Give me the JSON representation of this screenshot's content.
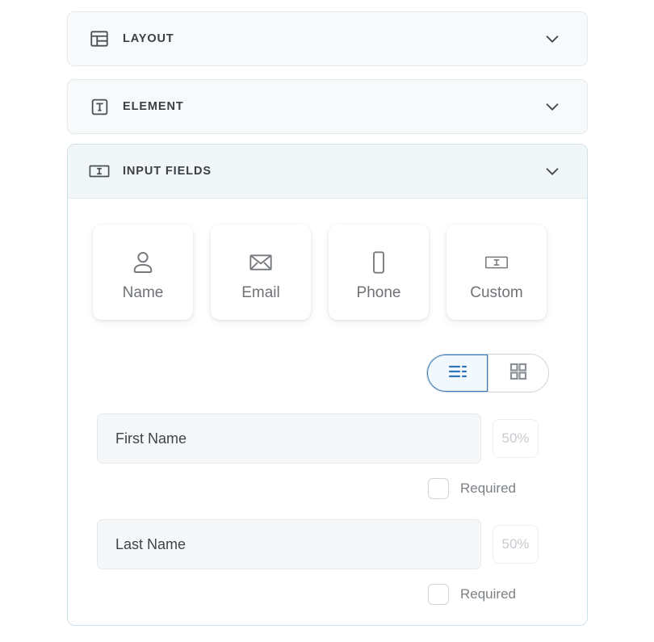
{
  "sections": [
    {
      "id": "layout",
      "title": "LAYOUT",
      "icon": "layout-icon",
      "expanded": false,
      "chevron": "chevron-down-icon"
    },
    {
      "id": "element",
      "title": "ELEMENT",
      "icon": "text-element-icon",
      "expanded": false,
      "chevron": "chevron-down-icon"
    },
    {
      "id": "input-fields",
      "title": "INPUT FIELDS",
      "icon": "input-field-icon",
      "expanded": true,
      "chevron": "chevron-down-icon"
    }
  ],
  "field_types": [
    {
      "id": "name",
      "label": "Name",
      "icon": "person-icon"
    },
    {
      "id": "email",
      "label": "Email",
      "icon": "envelope-icon"
    },
    {
      "id": "phone",
      "label": "Phone",
      "icon": "mobile-phone-icon"
    },
    {
      "id": "custom",
      "label": "Custom",
      "icon": "input-field-icon"
    }
  ],
  "view_toggle": {
    "options": [
      {
        "id": "list",
        "icon": "list-view-icon",
        "selected": true
      },
      {
        "id": "grid",
        "icon": "grid-view-icon",
        "selected": false
      }
    ]
  },
  "fields": [
    {
      "label": "First Name",
      "placeholder": "First Name",
      "width": "50%",
      "required_label": "Required",
      "required_checked": false
    },
    {
      "label": "Last Name",
      "placeholder": "Last Name",
      "width": "50%",
      "required_label": "Required",
      "required_checked": false
    }
  ],
  "colors": {
    "accent": "#2f76b8",
    "active_panel_border": "#cfe0ea",
    "active_panel_header": "#f1f6f8",
    "panel_bg": "#f7f9fa",
    "text": "#3b4046",
    "muted_text": "#7c8186"
  }
}
